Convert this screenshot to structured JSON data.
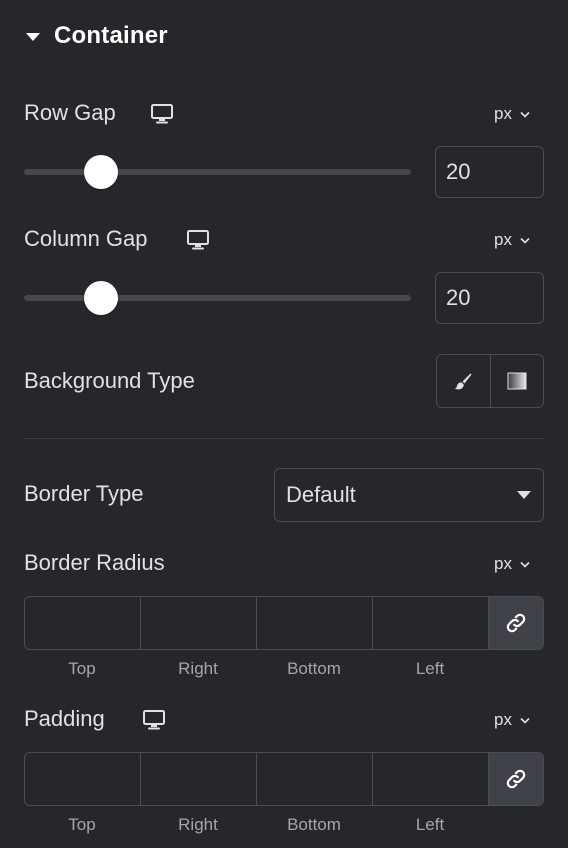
{
  "section": {
    "title": "Container"
  },
  "row_gap": {
    "label": "Row Gap",
    "unit": "px",
    "value": "20",
    "slider_fraction": 0.2
  },
  "column_gap": {
    "label": "Column Gap",
    "unit": "px",
    "value": "20",
    "slider_fraction": 0.2
  },
  "background_type": {
    "label": "Background Type",
    "options": [
      "brush-icon",
      "gradient-icon"
    ]
  },
  "border_type": {
    "label": "Border Type",
    "selected": "Default"
  },
  "border_radius": {
    "label": "Border Radius",
    "unit": "px",
    "sides": [
      "Top",
      "Right",
      "Bottom",
      "Left"
    ],
    "values": [
      "",
      "",
      "",
      ""
    ]
  },
  "padding": {
    "label": "Padding",
    "unit": "px",
    "sides": [
      "Top",
      "Right",
      "Bottom",
      "Left"
    ],
    "values": [
      "",
      "",
      "",
      ""
    ]
  },
  "colors": {
    "background": "#26272b",
    "border": "#4b4d52",
    "text": "#e0e1e3",
    "muted": "#a4a6ab",
    "link_button": "#404249"
  }
}
